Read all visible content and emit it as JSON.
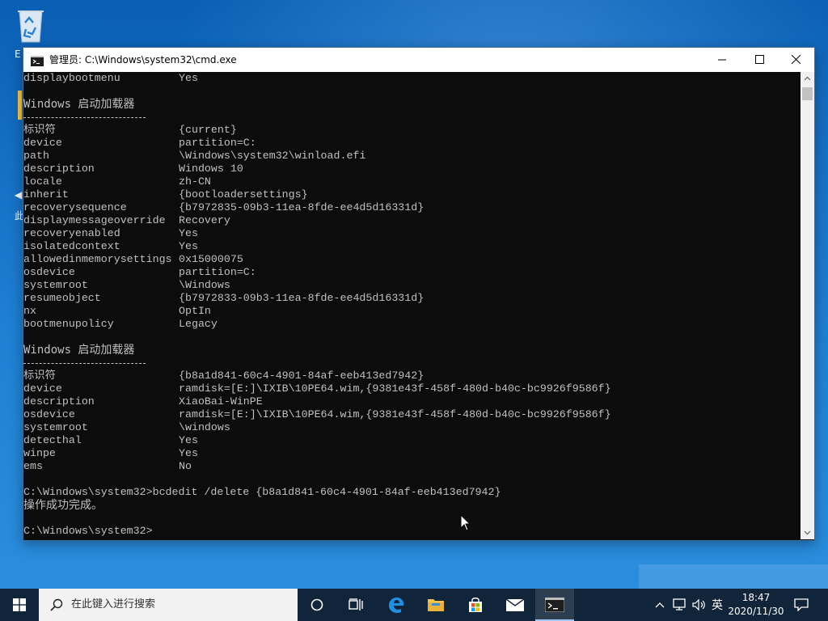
{
  "window": {
    "title": "管理员: C:\\Windows\\system32\\cmd.exe"
  },
  "console": {
    "top_entry": {
      "key": "displaybootmenu",
      "value": "Yes"
    },
    "section1": {
      "header": "Windows 启动加载器",
      "entries": [
        {
          "key": "标识符",
          "value": "{current}"
        },
        {
          "key": "device",
          "value": "partition=C:"
        },
        {
          "key": "path",
          "value": "\\Windows\\system32\\winload.efi"
        },
        {
          "key": "description",
          "value": "Windows 10"
        },
        {
          "key": "locale",
          "value": "zh-CN"
        },
        {
          "key": "inherit",
          "value": "{bootloadersettings}"
        },
        {
          "key": "recoverysequence",
          "value": "{b7972835-09b3-11ea-8fde-ee4d5d16331d}"
        },
        {
          "key": "displaymessageoverride",
          "value": "Recovery"
        },
        {
          "key": "recoveryenabled",
          "value": "Yes"
        },
        {
          "key": "isolatedcontext",
          "value": "Yes"
        },
        {
          "key": "allowedinmemorysettings",
          "value": "0x15000075"
        },
        {
          "key": "osdevice",
          "value": "partition=C:"
        },
        {
          "key": "systemroot",
          "value": "\\Windows"
        },
        {
          "key": "resumeobject",
          "value": "{b7972833-09b3-11ea-8fde-ee4d5d16331d}"
        },
        {
          "key": "nx",
          "value": "OptIn"
        },
        {
          "key": "bootmenupolicy",
          "value": "Legacy"
        }
      ]
    },
    "section2": {
      "header": "Windows 启动加载器",
      "entries": [
        {
          "key": "标识符",
          "value": "{b8a1d841-60c4-4901-84af-eeb413ed7942}"
        },
        {
          "key": "device",
          "value": "ramdisk=[E:]\\IXIB\\10PE64.wim,{9381e43f-458f-480d-b40c-bc9926f9586f}"
        },
        {
          "key": "description",
          "value": "XiaoBai-WinPE"
        },
        {
          "key": "osdevice",
          "value": "ramdisk=[E:]\\IXIB\\10PE64.wim,{9381e43f-458f-480d-b40c-bc9926f9586f}"
        },
        {
          "key": "systemroot",
          "value": "\\windows"
        },
        {
          "key": "detecthal",
          "value": "Yes"
        },
        {
          "key": "winpe",
          "value": "Yes"
        },
        {
          "key": "ems",
          "value": "No"
        }
      ]
    },
    "command_line": "C:\\Windows\\system32>bcdedit /delete {b8a1d841-60c4-4901-84af-eeb413ed7942}",
    "result_line": "操作成功完成。",
    "prompt_line": "C:\\Windows\\system32>"
  },
  "taskbar": {
    "search_placeholder": "在此键入进行搜索",
    "ime_label": "英",
    "time": "18:47",
    "date": "2020/11/30"
  },
  "colors": {
    "console_bg": "#0c0c0c",
    "console_text": "#c0c0c0",
    "taskbar_bg": "#10243a"
  }
}
